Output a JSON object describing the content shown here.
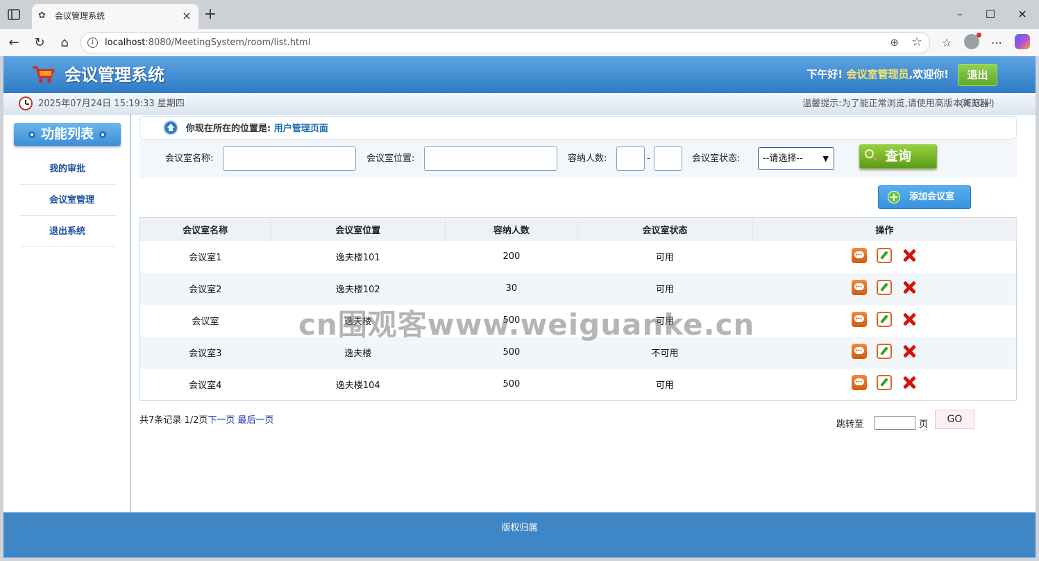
{
  "browser": {
    "tab_title": "会议管理系统",
    "url_host": "localhost",
    "url_rest": ":8080/MeetingSystem/room/list.html"
  },
  "header": {
    "app_title": "会议管理系统",
    "greeting": "下午好!",
    "role": "会议室管理员",
    "welcome": ",欢迎你!",
    "logout_label": "退出"
  },
  "infobar": {
    "datetime": "2025年07月24日 15:19:33 星期四",
    "tip": "温馨提示:为了能正常浏览,请使用高版本浏览器!",
    "tip_ie": "(IE10+)"
  },
  "sidebar": {
    "title": "功能列表",
    "items": [
      {
        "label": "我的审批"
      },
      {
        "label": "会议室管理"
      },
      {
        "label": "退出系统"
      }
    ]
  },
  "location": {
    "prefix": "你现在所在的位置是:",
    "page": "用户管理页面"
  },
  "search": {
    "name_label": "会议室名称:",
    "location_label": "会议室位置:",
    "capacity_label": "容纳人数:",
    "dash": "-",
    "status_label": "会议室状态:",
    "status_selected": "--请选择--",
    "query_label": "查询"
  },
  "add_button": "添加会议室",
  "table": {
    "headers": [
      "会议室名称",
      "会议室位置",
      "容纳人数",
      "会议室状态",
      "操作"
    ],
    "rows": [
      [
        "会议室1",
        "逸夫楼101",
        "200",
        "可用"
      ],
      [
        "会议室2",
        "逸夫楼102",
        "30",
        "可用"
      ],
      [
        "会议室",
        "逸夫楼",
        "500",
        "可用"
      ],
      [
        "会议室3",
        "逸夫楼",
        "500",
        "不可用"
      ],
      [
        "会议室4",
        "逸夫楼104",
        "500",
        "可用"
      ]
    ]
  },
  "pager": {
    "summary": "共7条记录",
    "page_info": "1/2页",
    "next": "下一页",
    "last": "最后一页",
    "jump_label": "跳转至",
    "jump_unit": "页",
    "go_label": "GO"
  },
  "footer": "版权归属",
  "watermark": "cn围观客www.weiguanke.cn",
  "colors": {
    "header_blue": "#2f7cc6",
    "footer_blue": "#3f86c7",
    "role_yellow": "#ffe66b",
    "logout_green": "#5ea82a",
    "query_green": "#5b9a18",
    "delete_red": "#d31212"
  }
}
